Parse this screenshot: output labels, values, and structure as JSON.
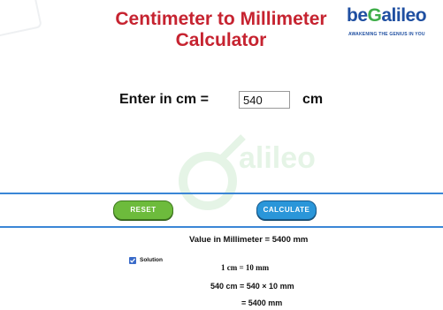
{
  "header": {
    "title_line1": "Centimeter to Millimeter",
    "title_line2": "Calculator",
    "logo_prefix": "be",
    "logo_g": "G",
    "logo_suffix": "alileo",
    "logo_tagline": "AWAKENING THE GENIUS IN YOU"
  },
  "form": {
    "label": "Enter in cm =",
    "input_value": "540",
    "unit": "cm"
  },
  "buttons": {
    "reset": "RESET",
    "calculate": "CALCULATE"
  },
  "result": {
    "text": "Value in Millimeter = 5400 mm",
    "solution_label": "Solution",
    "solution_checked": true,
    "steps": [
      "1 cm = 10 mm",
      "540 cm = 540 × 10 mm",
      "= 5400 mm"
    ]
  },
  "colors": {
    "title": "#c62330",
    "reset_button": "#6dbb3c",
    "calculate_button": "#2a96d9",
    "band_lines": "#3a86d6"
  }
}
